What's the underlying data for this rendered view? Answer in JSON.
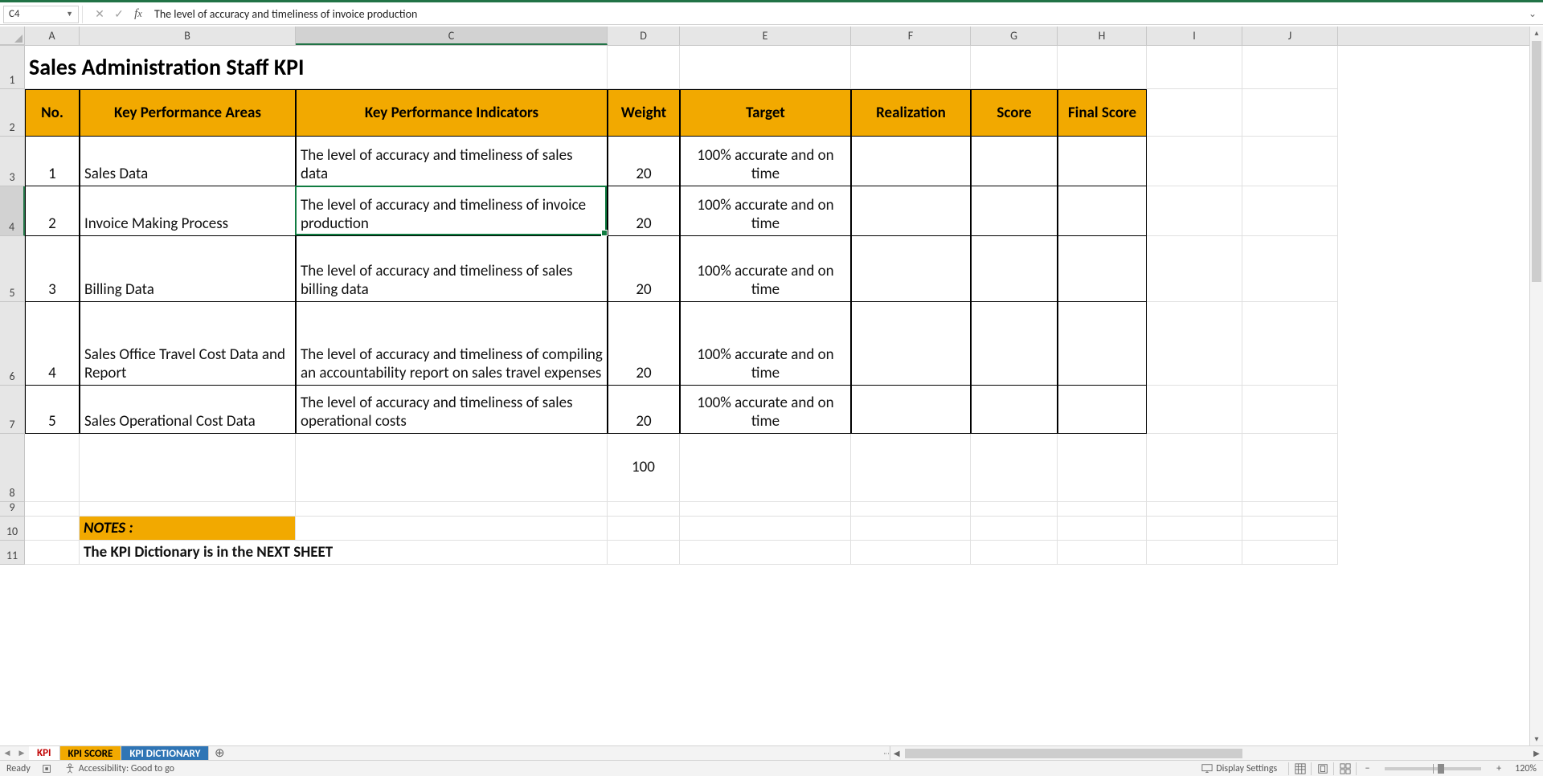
{
  "formula_bar": {
    "name_box": "C4",
    "formula": "The level of accuracy and timeliness of invoice production"
  },
  "columns": [
    "A",
    "B",
    "C",
    "D",
    "E",
    "F",
    "G",
    "H",
    "I",
    "J"
  ],
  "col_widths": [
    "cw-A",
    "cw-B",
    "cw-C",
    "cw-D",
    "cw-E",
    "cw-F",
    "cw-G",
    "cw-H",
    "cw-I",
    "cw-J"
  ],
  "selected_col": "C",
  "selected_row": "4",
  "title": "Sales Administration Staff KPI",
  "headers": {
    "no": "No.",
    "kpa": "Key Performance Areas",
    "kpi": "Key Performance Indicators",
    "weight": "Weight",
    "target": "Target",
    "realization": "Realization",
    "score": "Score",
    "final_score": "Final Score"
  },
  "rows": [
    {
      "no": "1",
      "kpa": "Sales Data",
      "kpi": "The level of accuracy and timeliness of sales data",
      "weight": "20",
      "target": "100% accurate and on time"
    },
    {
      "no": "2",
      "kpa": "Invoice Making Process",
      "kpi": "The level of accuracy and timeliness of invoice production",
      "weight": "20",
      "target": "100% accurate and on time"
    },
    {
      "no": "3",
      "kpa": "Billing Data",
      "kpi": "The level of accuracy and timeliness of sales billing data",
      "weight": "20",
      "target": "100% accurate and on time"
    },
    {
      "no": "4",
      "kpa": "Sales Office Travel Cost Data and Report",
      "kpi": "The level of accuracy and timeliness of compiling an accountability report on sales travel expenses",
      "weight": "20",
      "target": "100% accurate and on time"
    },
    {
      "no": "5",
      "kpa": "Sales Operational Cost Data",
      "kpi": "The level of accuracy and timeliness of sales operational costs",
      "weight": "20",
      "target": "100% accurate and on time"
    }
  ],
  "total_weight": "100",
  "notes_label": "NOTES :",
  "notes_text": "The KPI Dictionary is in the NEXT SHEET",
  "row_heights": {
    "1": 54,
    "2": 59,
    "3": 62,
    "4": 62,
    "5": 82,
    "6": 104,
    "7": 60,
    "8": 85,
    "9": 18,
    "10": 30,
    "11": 30
  },
  "sheet_tabs": {
    "active": "KPI",
    "second": "KPI SCORE",
    "third": "KPI DICTIONARY"
  },
  "status": {
    "ready": "Ready",
    "accessibility": "Accessibility: Good to go",
    "display": "Display Settings",
    "zoom": "120%"
  }
}
